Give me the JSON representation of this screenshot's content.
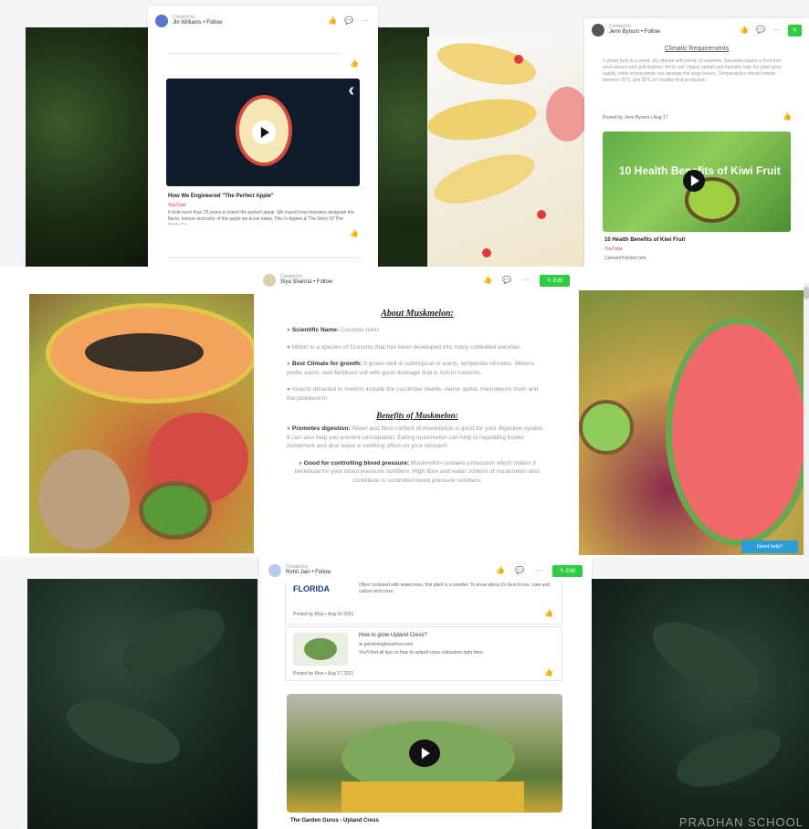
{
  "top_card_a": {
    "created_by": "Created by",
    "user": "Jin Williams • Follow",
    "video_title": "How We Engineered \"The Perfect Apple\"",
    "source_badge": "YouTube",
    "description": "It took more than 25 years to breed the perfect apple. We traced how breeders designed the flavor, texture and color of the apple we know today. This Is Apples & The Story Of The Apple Co."
  },
  "top_card_b": {
    "created_by": "Created by",
    "user": "Jenn Bynum • Follow",
    "title": "Climatic Requirements",
    "body": "It grows best in a warm, dry climate with plenty of sunshine. Bananas require a frost-free environment and well-drained, fertile soil. Heavy rainfall and humidity help the plant grow rapidly, while strong winds can damage the large leaves. Temperatures should remain between 26°C and 30°C for healthy fruit production.",
    "posted_by": "Posted by Jenn Bynum • Aug 17",
    "video_overlay": "10 Health Benefits of Kiwi Fruit",
    "video_title": "10 Health Benefits of Kiwi Fruit",
    "source_badge": "YouTube",
    "footer": "Canwell Kitchen Info"
  },
  "middle_card": {
    "created_by": "Created by",
    "user": "Siya Sharma • Follow",
    "edit_label": "Edit",
    "about_heading": "About Muskmelon:",
    "sci_label": "Scientific Name:",
    "sci_value": "Cucumis melo",
    "p_melon": "Melon is a species of Cucumis that has been developed into many cultivated varieties.",
    "climate_label": "Best Climate for growth:",
    "climate_value": "It grows well in subtropical or warm, temperate climates. Melons prefer warm, well-fertilised soil with good drainage that is rich in nutrients.",
    "pests": "Insects attracted to melons include the cucumber beetle, melon aphid, melonworm moth and the pickleworm.",
    "benefits_heading": "Benefits of Muskmelon:",
    "digestion_label": "Promotes digestion:",
    "digestion_value": "Water and fibre content of muskmelon is good for your digestive system. It can also help you prevent constipation. Eating muskmelon can help in regulating bowel movement and also leave a soothing effect on your stomach.",
    "bp_label": "Good for controlling blood pressure:",
    "bp_value": "Muskmelon contains potassium which makes it beneficial for your blood pressure numbers. High fibre and water content of muskmelon also contribute to controlled blood pressure numbers.",
    "help_label": "Need help?"
  },
  "bottom_card": {
    "created_by": "Created by",
    "user": "Rohit Jain • Follow",
    "edit_label": "Edit",
    "logo_text": "FLORIDA",
    "snippet": "Often confused with watercress, this plant is a wonder. To know about it's best to live, care and culture tech here.",
    "posted1": "Posted by Riya • Aug 16 2021",
    "link_title": "How to grow Upland Cress?",
    "link_domain": "gardeningknowhow.com",
    "link_desc": "You'll find all tips on how to upland cress cultivation right here.",
    "posted2": "Posted by Riya • Aug 17 2021",
    "video_title": "The Garden Gurus - Upland Cress"
  },
  "watermark": "PRADHAN SCHOOL",
  "icons": [
    "like-icon",
    "comment-icon",
    "more-icon",
    "edit-icon",
    "play-icon",
    "back-chevron-icon",
    "youtube-icon",
    "link-icon"
  ],
  "colors": {
    "accent_green": "#2ecc40",
    "dark_leaf": "#1d2a22",
    "help_blue": "#2d9cdb"
  }
}
